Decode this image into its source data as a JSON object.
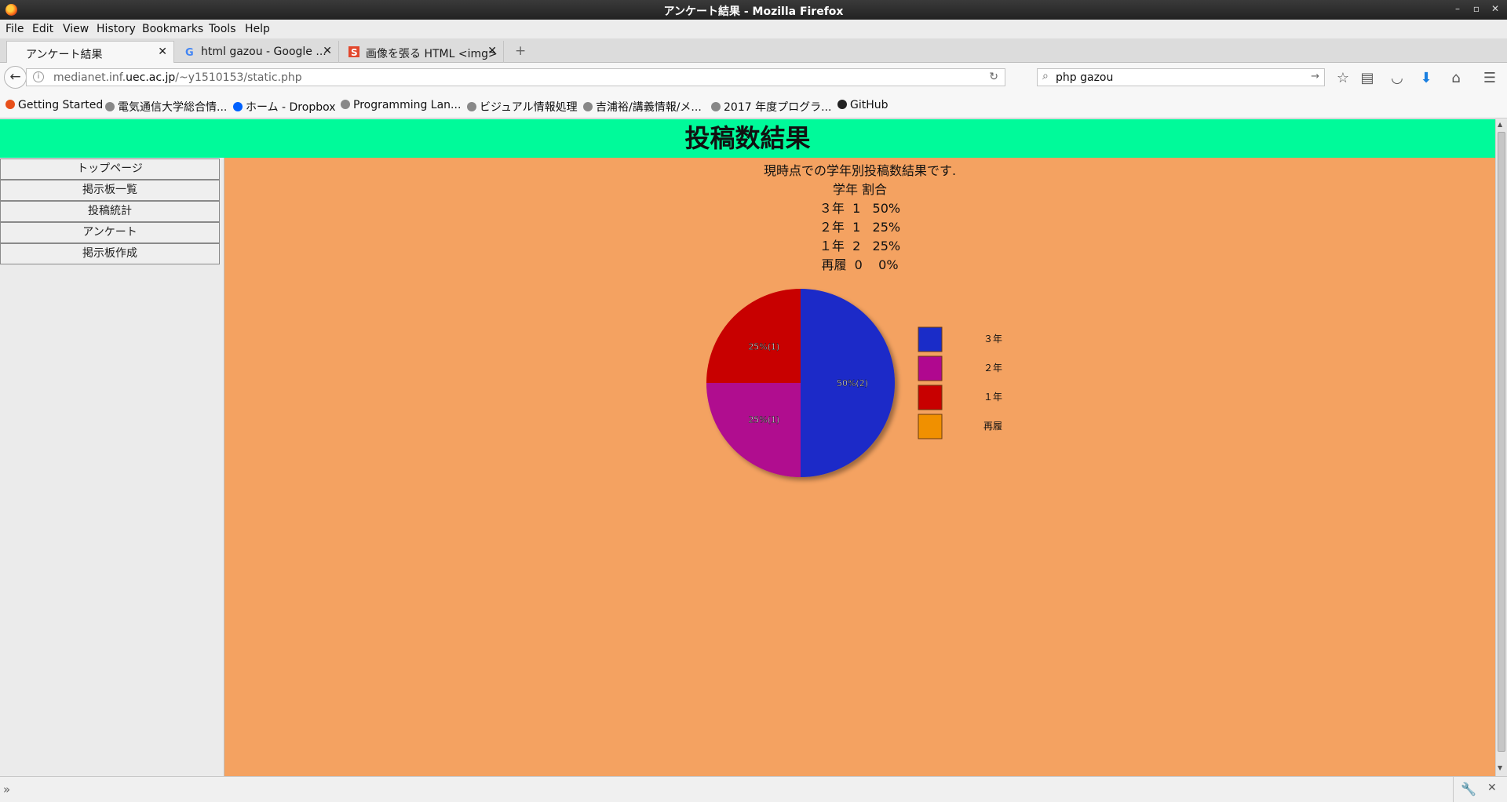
{
  "window": {
    "title": "アンケート結果  - Mozilla Firefox"
  },
  "menu": [
    "File",
    "Edit",
    "View",
    "History",
    "Bookmarks",
    "Tools",
    "Help"
  ],
  "tabs": [
    {
      "label": "アンケート結果",
      "active": true
    },
    {
      "label": "html gazou - Google ...",
      "active": false
    },
    {
      "label": "画像を張る HTML <img>",
      "active": false
    }
  ],
  "navbar": {
    "url_prefix": "medianet.inf.",
    "url_host": "uec.ac.jp",
    "url_path": "/~y1510153/static.php",
    "search_value": "php gazou"
  },
  "bookmarks": [
    "Getting Started",
    "電気通信大学総合情...",
    "ホーム - Dropbox",
    "Programming Lan...",
    "ビジュアル情報処理",
    "吉浦裕/講義情報/メ...",
    "2017 年度プログラ...",
    "GitHub"
  ],
  "page": {
    "heading": "投稿数結果",
    "nav": [
      "トップページ",
      "掲示板一覧",
      "投稿統計",
      "アンケート",
      "掲示板作成"
    ],
    "intro": "現時点での学年別投稿数結果です.",
    "table_header": "学年 割合",
    "rows": [
      "３年  1   50%",
      "２年  1   25%",
      "１年  2   25%",
      "再履  0    0%"
    ]
  },
  "chart_data": {
    "type": "pie",
    "categories": [
      "３年",
      "２年",
      "１年",
      "再履"
    ],
    "values": [
      2,
      1,
      1,
      0
    ],
    "percent_labels": [
      "50%(2)",
      "25%(1)",
      "25%(1)",
      ""
    ],
    "colors": [
      "#1a2cc8",
      "#b0088f",
      "#c80000",
      "#f09000"
    ],
    "legend": "right"
  }
}
